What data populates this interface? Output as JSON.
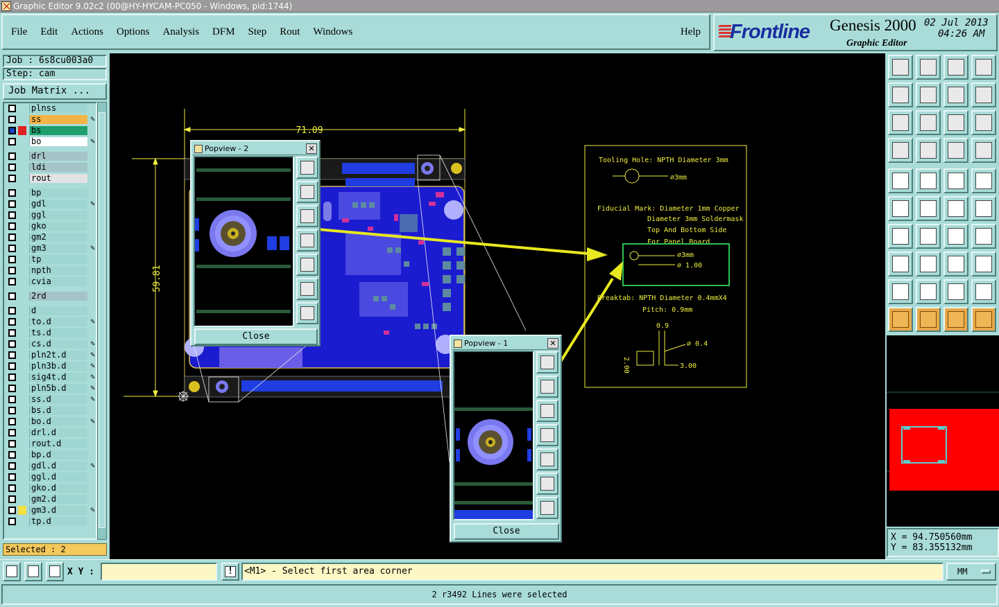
{
  "window": {
    "title": "Graphic Editor 9.02c2 (00@HY-HYCAM-PC050 - Windows, pid:1744)"
  },
  "menu": {
    "items": [
      "File",
      "Edit",
      "Actions",
      "Options",
      "Analysis",
      "DFM",
      "Step",
      "Rout",
      "Windows"
    ],
    "help": "Help"
  },
  "logo": {
    "brand": "Frontline",
    "product": "Genesis 2000",
    "subtitle": "Graphic Editor",
    "date": "02 Jul 2013",
    "time": "04:26 AM"
  },
  "job": {
    "job_label": "Job : 6s8cu003a0",
    "step_label": "Step: cam",
    "job_matrix_button": "Job Matrix ..."
  },
  "layers": [
    {
      "name": "plnss",
      "color": "#9fd6d2",
      "pen": false
    },
    {
      "name": "ss",
      "color": "#f3b445",
      "pen": true
    },
    {
      "name": "bs",
      "color": "#1e9e6a",
      "pen": false,
      "active": true
    },
    {
      "name": "bo",
      "color": "#ffffff",
      "pen": true
    },
    {
      "name": "drl",
      "color": "#a4c4c8",
      "pen": false
    },
    {
      "name": "ldi",
      "color": "#a4c4c8",
      "pen": false
    },
    {
      "name": "rout",
      "color": "#e2e2e2",
      "pen": false
    },
    {
      "name": "bp",
      "color": "#9fd6d2",
      "pen": false
    },
    {
      "name": "gdl",
      "color": "#9fd6d2",
      "pen": true
    },
    {
      "name": "ggl",
      "color": "#9fd6d2",
      "pen": false
    },
    {
      "name": "gko",
      "color": "#9fd6d2",
      "pen": false
    },
    {
      "name": "gm2",
      "color": "#9fd6d2",
      "pen": false
    },
    {
      "name": "gm3",
      "color": "#9fd6d2",
      "pen": true
    },
    {
      "name": "tp",
      "color": "#9fd6d2",
      "pen": false
    },
    {
      "name": "npth",
      "color": "#9fd6d2",
      "pen": false
    },
    {
      "name": "cvia",
      "color": "#9fd6d2",
      "pen": false
    },
    {
      "name": "2rd",
      "color": "#a4c4c8",
      "pen": false
    },
    {
      "name": "d",
      "color": "#9fd6d2",
      "pen": false
    },
    {
      "name": "to.d",
      "color": "#9fd6d2",
      "pen": true
    },
    {
      "name": "ts.d",
      "color": "#9fd6d2",
      "pen": false
    },
    {
      "name": "cs.d",
      "color": "#9fd6d2",
      "pen": true
    },
    {
      "name": "pln2t.d",
      "color": "#9fd6d2",
      "pen": true
    },
    {
      "name": "pln3b.d",
      "color": "#9fd6d2",
      "pen": true
    },
    {
      "name": "sig4t.d",
      "color": "#9fd6d2",
      "pen": true
    },
    {
      "name": "pln5b.d",
      "color": "#9fd6d2",
      "pen": true
    },
    {
      "name": "ss.d",
      "color": "#9fd6d2",
      "pen": true
    },
    {
      "name": "bs.d",
      "color": "#9fd6d2",
      "pen": false
    },
    {
      "name": "bo.d",
      "color": "#9fd6d2",
      "pen": true
    },
    {
      "name": "drl.d",
      "color": "#9fd6d2",
      "pen": false
    },
    {
      "name": "rout.d",
      "color": "#9fd6d2",
      "pen": false
    },
    {
      "name": "bp.d",
      "color": "#9fd6d2",
      "pen": false
    },
    {
      "name": "gdl.d",
      "color": "#9fd6d2",
      "pen": true
    },
    {
      "name": "ggl.d",
      "color": "#9fd6d2",
      "pen": false
    },
    {
      "name": "gko.d",
      "color": "#9fd6d2",
      "pen": false
    },
    {
      "name": "gm2.d",
      "color": "#9fd6d2",
      "pen": false
    },
    {
      "name": "gm3.d",
      "color": "#9fd6d2",
      "pen": true,
      "marker": "#f0e040"
    },
    {
      "name": "tp.d",
      "color": "#9fd6d2",
      "pen": false
    }
  ],
  "selected_count": "Selected : 2",
  "canvas": {
    "dim_width": "71.09",
    "dim_height": "59.81",
    "notes": {
      "tooling": "Tooling Hole: NPTH  Diameter 3mm",
      "tooling_dia": "⌀3mm",
      "fiducial_1": "Fiducial Mark: Diameter 1mm Copper",
      "fiducial_2": "Diameter 3mm Soldermask",
      "fiducial_3": "Top And Bottom Side",
      "fiducial_4": "For Panel Board",
      "fid_dia_3": "⌀3mm",
      "fid_dia_1": "⌀ 1.00",
      "breaktab_1": "Breaktab: NPTH   Diameter 0.4mmX4",
      "breaktab_2": "Pitch: 0.9mm",
      "bt_09": "0.9",
      "bt_04": "⌀ 0.4",
      "bt_300": "3.00",
      "bt_200": "2.00"
    }
  },
  "popviews": [
    {
      "title": "Popview - 2",
      "close": "Close"
    },
    {
      "title": "Popview - 1",
      "close": "Close"
    }
  ],
  "coordinates": {
    "x": "X  =  94.750560mm",
    "y": "Y  =  83.355132mm"
  },
  "command": {
    "xy_label": "X Y :",
    "xy_value": "",
    "excl": "!",
    "prompt": "<M1> - Select first area corner",
    "units": "MM"
  },
  "status": "2 r3492 Lines were selected"
}
